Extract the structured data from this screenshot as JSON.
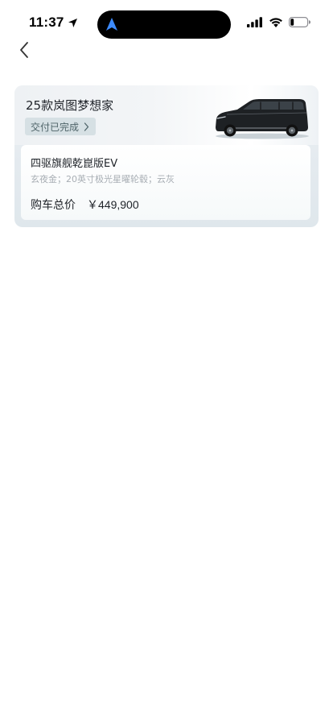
{
  "status_bar": {
    "time": "11:37",
    "location_icon": "location-arrow-icon",
    "island_icon": "navigation-arrow-icon",
    "signal_icon": "cellular-signal-icon",
    "wifi_icon": "wifi-icon",
    "battery_icon": "battery-low-icon",
    "battery_level": 0.2
  },
  "nav": {
    "back_icon": "chevron-left-icon"
  },
  "order": {
    "model_title": "25款岚图梦想家",
    "delivery_status": "交付已完成",
    "config_name": "四驱旗舰乾崑版EV",
    "config_options": "玄夜金；20英寸极光星曜轮毂；云灰",
    "price_label": "购车总价",
    "price_value": "￥449,900"
  },
  "colors": {
    "card_bg": "#e4eaef",
    "tag_bg": "#d6e0e4",
    "tag_text": "#4f6469",
    "muted_text": "#a8aeb4",
    "island_accent": "#3d8bfd"
  }
}
